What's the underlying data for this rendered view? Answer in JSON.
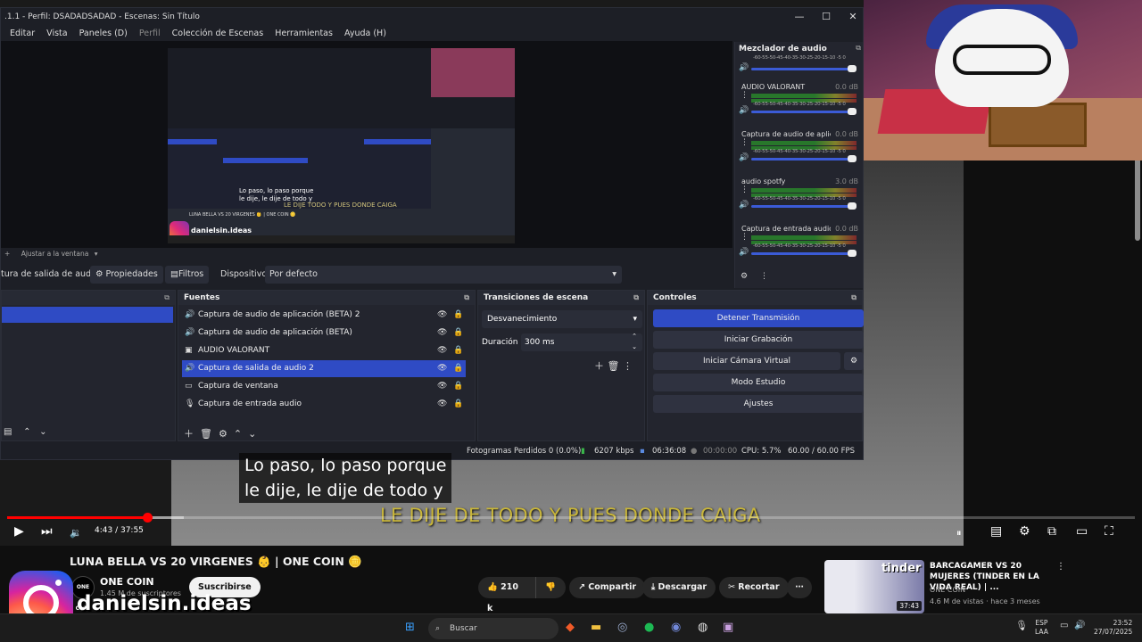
{
  "obs": {
    "title": ".1.1 - Perfil: DSADADSADAD - Escenas: Sin Título",
    "menu": [
      "Editar",
      "Vista",
      "Paneles (D)",
      "Perfil",
      "Colección de Escenas",
      "Herramientas",
      "Ayuda (H)"
    ],
    "zoom_label": "Ajustar a la ventana",
    "toolbar": {
      "source_label": "tura de salida de audio",
      "properties": "Propiedades",
      "filters": "Filtros",
      "device_label": "Dispositivo",
      "device_value": "Por defecto"
    },
    "mixer": {
      "title": "Mezclador de audio",
      "ticks": "-60-55-50-45-40-35-30-25-20-15-10 -5 0",
      "channels": [
        {
          "name": "",
          "db": ""
        },
        {
          "name": "AUDIO VALORANT",
          "db": "0.0 dB"
        },
        {
          "name": "Captura de audio de aplicació",
          "db": "0.0 dB"
        },
        {
          "name": "audio spotfy",
          "db": "3.0 dB"
        },
        {
          "name": "Captura de entrada audio",
          "db": "0.0 dB"
        }
      ]
    },
    "sources": {
      "title": "Fuentes",
      "items": [
        {
          "label": "Captura de audio de aplicación (BETA) 2",
          "icon": "🔊"
        },
        {
          "label": "Captura de audio de aplicación (BETA)",
          "icon": "🔊"
        },
        {
          "label": "AUDIO VALORANT",
          "icon": "▣"
        },
        {
          "label": "Captura de salida de audio 2",
          "icon": "🔊"
        },
        {
          "label": "Captura de ventana",
          "icon": "▭"
        },
        {
          "label": "Captura de entrada audio",
          "icon": "🎙"
        }
      ]
    },
    "transitions": {
      "title": "Transiciones de escena",
      "selected": "Desvanecimiento",
      "duration_label": "Duración",
      "duration_value": "300 ms"
    },
    "controls": {
      "title": "Controles",
      "stop_stream": "Detener Transmisión",
      "start_record": "Iniciar Grabación",
      "start_virtual_cam": "Iniciar Cámara Virtual",
      "studio_mode": "Modo Estudio",
      "settings": "Ajustes"
    },
    "status": {
      "dropped": "Fotogramas Perdidos 0 (0.0%)",
      "bitrate": "6207 kbps",
      "stream_time": "06:36:08",
      "rec_time": "00:00:00",
      "cpu": "CPU: 5.7%",
      "fps": "60.00 / 60.00 FPS"
    },
    "preview": {
      "sub1": "Lo paso, lo paso porque",
      "sub2": "le dije, le dije de todo y",
      "lyric": "LE DIJE TODO Y PUES DONDE CAIGA",
      "insta": "danielsin.ideas",
      "video_title": "LUNA BELLA VS 20 VIRGENES 👶 | ONE COIN 🪙"
    }
  },
  "player": {
    "subtitle_line1": "Lo paso, lo paso porque",
    "subtitle_line2": "le dije, le dije de todo y",
    "lyric": "LE DIJE DE TODO Y PUES DONDE CAIGA",
    "time": "4:43 / 37:55",
    "progress_fraction": 0.1244
  },
  "video": {
    "title": "LUNA BELLA VS 20 VIRGENES 👶 | ONE COIN 🪙",
    "channel": "ONE COIN",
    "channel_avatar_text": "ONE COIN",
    "subscribers": "1.45 M de suscriptores",
    "subscribe": "Suscribirse",
    "likes": "210 k",
    "share": "Compartir",
    "download": "Descargar",
    "clip": "Recortar",
    "more": "⋯"
  },
  "recommendation": {
    "title": "BARCAGAMER VS 20 MUJERES (TINDER EN LA VIDA REAL) | ...",
    "channel": "ONE COIN",
    "views": "4.6 M de vistas · hace 3 meses",
    "duration": "37:43",
    "thumb_text": "tinder"
  },
  "overlay": {
    "instagram": "danielsin.ideas"
  },
  "taskbar": {
    "search": "Buscar",
    "lang1": "ESP",
    "lang2": "LAA",
    "time": "23:52",
    "date": "27/07/2025"
  }
}
